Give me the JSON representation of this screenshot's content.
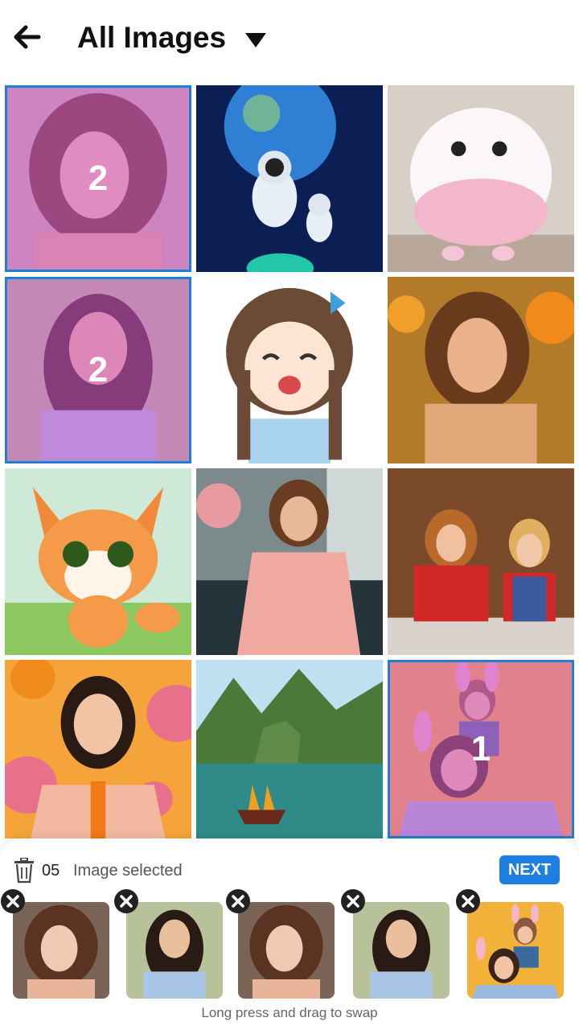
{
  "header": {
    "title": "All Images",
    "back_icon": "arrow-left-icon",
    "dropdown_icon": "caret-down-icon"
  },
  "grid": {
    "images": [
      {
        "subject": "woman-short-hair",
        "selected": true,
        "order": "2"
      },
      {
        "subject": "astronauts-earth",
        "selected": false,
        "order": ""
      },
      {
        "subject": "fluffy-creature",
        "selected": false,
        "order": ""
      },
      {
        "subject": "smiling-woman",
        "selected": true,
        "order": "2"
      },
      {
        "subject": "anime-girl",
        "selected": false,
        "order": ""
      },
      {
        "subject": "woman-water",
        "selected": false,
        "order": ""
      },
      {
        "subject": "cartoon-fox",
        "selected": false,
        "order": ""
      },
      {
        "subject": "woman-train",
        "selected": false,
        "order": ""
      },
      {
        "subject": "mother-daughter-baking",
        "selected": false,
        "order": ""
      },
      {
        "subject": "woman-polka-dots",
        "selected": false,
        "order": ""
      },
      {
        "subject": "bay-boat",
        "selected": false,
        "order": ""
      },
      {
        "subject": "mother-child-bunny-ears",
        "selected": true,
        "order": "1"
      }
    ]
  },
  "selection": {
    "count": "05",
    "label": "Image selected",
    "next_label": "NEXT",
    "trash_icon": "trash-icon",
    "remove_icon": "close-icon",
    "thumbnails": [
      "woman-short-hair",
      "smiling-woman",
      "woman-short-hair",
      "smiling-woman",
      "mother-child-bunny-ears"
    ],
    "hint": "Long press and drag to swap"
  },
  "colors": {
    "accent": "#1f7fe0",
    "selection_tint": "#d25acd"
  }
}
